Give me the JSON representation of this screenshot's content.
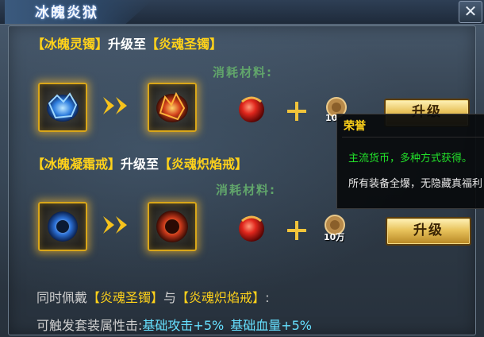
{
  "window": {
    "title": "冰魄炎狱",
    "close_icon": "close-icon"
  },
  "section1": {
    "from_item": "【冰魄灵镯】",
    "connector": "升级至",
    "to_item": "【炎魂圣镯】",
    "material_label": "消耗材料:",
    "coin_quantity": "10",
    "button_label": "升级"
  },
  "section2": {
    "from_item": "【冰魄凝霜戒】",
    "connector": "升级至",
    "to_item": "【炎魂炽焰戒】",
    "material_label": "消耗材料:",
    "coin_quantity": "10万",
    "button_label": "升级"
  },
  "set_bonus": {
    "line1_prefix": "同时佩戴",
    "item1": "【炎魂圣镯】",
    "joiner": "与",
    "item2": "【炎魂炽焰戒】",
    "line1_suffix": ":",
    "line2_prefix": "可触发套装属性击:",
    "stat1": "基础攻击+5%",
    "stat2": "基础血量+5%"
  },
  "tooltip": {
    "title": "荣誉",
    "line1": "主流货币，多种方式获得。",
    "line2": "所有装备全爆，无隐藏真福利"
  },
  "colors": {
    "item_name": "#ffd21a",
    "material_label": "#61a56b",
    "stat_text": "#66e0ff",
    "tooltip_green": "#22e22a"
  }
}
